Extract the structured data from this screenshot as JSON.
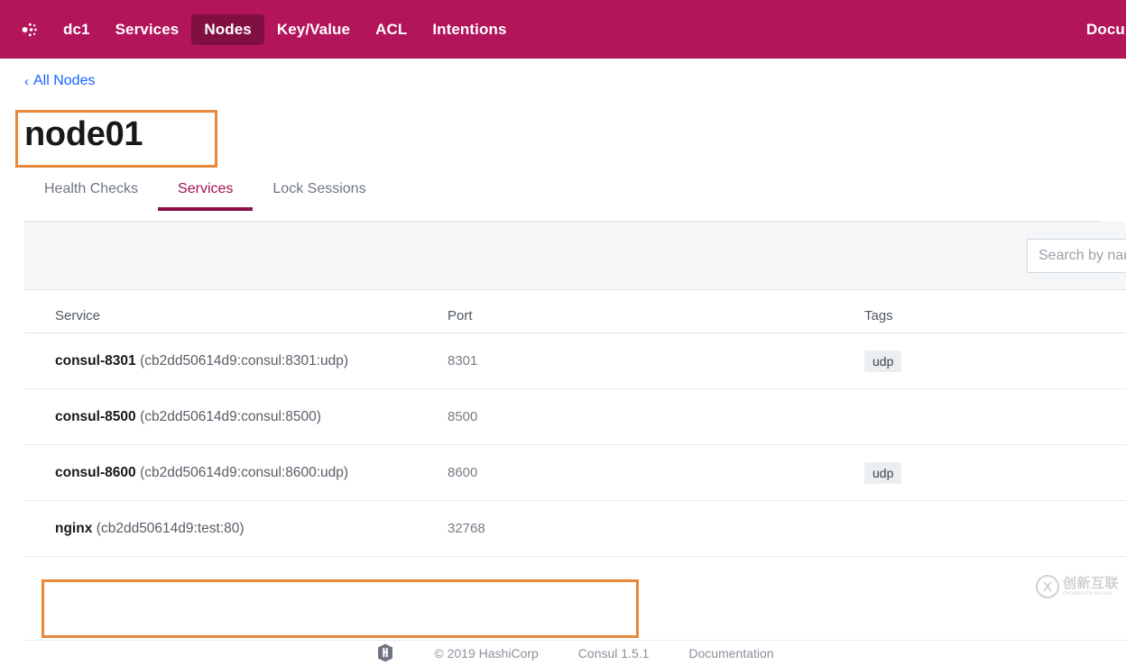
{
  "topnav": {
    "logo_icon": "consul-logo-icon",
    "brand_color": "#b3155a",
    "active_pill_color": "#801042",
    "items": [
      {
        "label": "dc1",
        "active": false
      },
      {
        "label": "Services",
        "active": false
      },
      {
        "label": "Nodes",
        "active": true
      },
      {
        "label": "Key/Value",
        "active": false
      },
      {
        "label": "ACL",
        "active": false
      },
      {
        "label": "Intentions",
        "active": false
      }
    ],
    "right_label": "Documentation"
  },
  "breadcrumb": {
    "chevron_icon": "chevron-left-icon",
    "label": "All Nodes",
    "color": "#1563ff"
  },
  "page_title": "node01",
  "tabs": [
    {
      "label": "Health Checks",
      "active": false
    },
    {
      "label": "Services",
      "active": true
    },
    {
      "label": "Lock Sessions",
      "active": false
    }
  ],
  "active_tab_color": "#a1114f",
  "search": {
    "value": "",
    "placeholder": "Search by name"
  },
  "table": {
    "columns": [
      "Service",
      "Port",
      "Tags"
    ],
    "rows": [
      {
        "name": "consul-8301",
        "id": "(cb2dd50614d9:consul:8301:udp)",
        "port": "8301",
        "tags": [
          "udp"
        ]
      },
      {
        "name": "consul-8500",
        "id": "(cb2dd50614d9:consul:8500)",
        "port": "8500",
        "tags": []
      },
      {
        "name": "consul-8600",
        "id": "(cb2dd50614d9:consul:8600:udp)",
        "port": "8600",
        "tags": [
          "udp"
        ]
      },
      {
        "name": "nginx",
        "id": "(cb2dd50614d9:test:80)",
        "port": "32768",
        "tags": []
      }
    ]
  },
  "annotations": {
    "color": "#e8883a",
    "boxes": [
      "page-title",
      "nginx-row"
    ]
  },
  "footer": {
    "logo_icon": "hashicorp-logo-icon",
    "copyright": "© 2019 HashiCorp",
    "version": "Consul 1.5.1",
    "docs_label": "Documentation"
  },
  "watermark": {
    "mark": "X",
    "cn": "创新互联",
    "en": "CHUANGXIN HULIAN"
  }
}
